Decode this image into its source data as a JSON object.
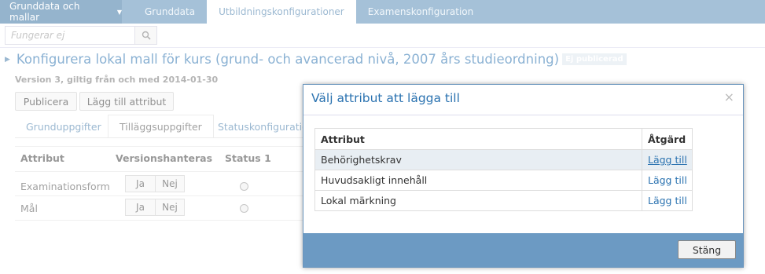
{
  "topnav": {
    "menu_label": "Grunddata och mallar",
    "tabs": [
      {
        "label": "Grunddata"
      },
      {
        "label": "Utbildningskonfigurationer"
      },
      {
        "label": "Examenskonfiguration"
      }
    ]
  },
  "search": {
    "placeholder": "Fungerar ej"
  },
  "page": {
    "title": "Konfigurera lokal mall för kurs (grund- och avancerad nivå, 2007 års studieordning)",
    "badge": "Ej publicerad",
    "version": "Version 3, giltig från och med 2014-01-30",
    "publish_label": "Publicera",
    "add_attribute_label": "Lägg till attribut",
    "subtabs": [
      {
        "label": "Grunduppgifter"
      },
      {
        "label": "Tilläggsuppgifter"
      },
      {
        "label": "Statuskonfiguration"
      }
    ],
    "table": {
      "headers": [
        "Attribut",
        "Versionshanteras",
        "Status 1"
      ],
      "rows": [
        {
          "attribut": "Examinationsform",
          "ja": "Ja",
          "nej": "Nej"
        },
        {
          "attribut": "Mål",
          "ja": "Ja",
          "nej": "Nej"
        }
      ]
    }
  },
  "modal": {
    "title": "Välj attribut att lägga till",
    "close_icon": "×",
    "headers": {
      "attribut": "Attribut",
      "action": "Åtgärd"
    },
    "rows": [
      {
        "name": "Behörighetskrav",
        "action": "Lägg till"
      },
      {
        "name": "Huvudsakligt innehåll",
        "action": "Lägg till"
      },
      {
        "name": "Lokal märkning",
        "action": "Lägg till"
      }
    ],
    "close_label": "Stäng"
  },
  "colors": {
    "nav": "#5b8fb8",
    "accent": "#2a72b0",
    "modal_footer": "#6c9ac3"
  }
}
